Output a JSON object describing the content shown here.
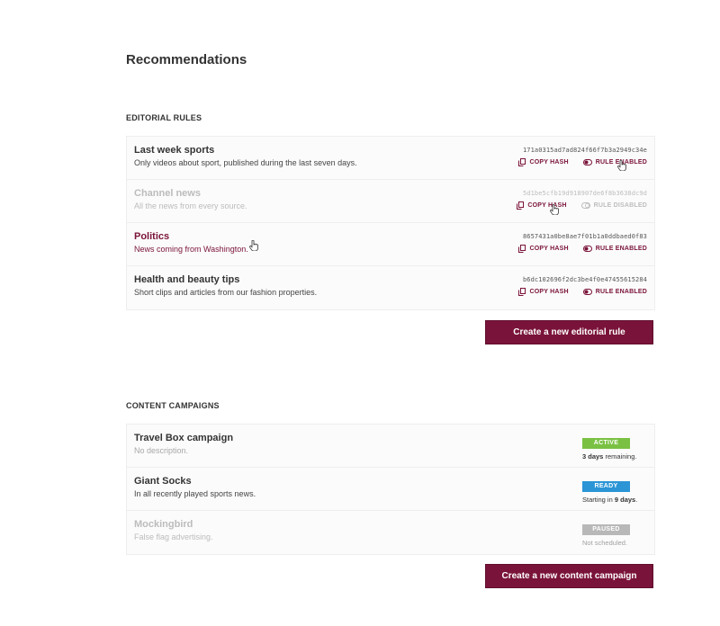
{
  "page": {
    "title": "Recommendations"
  },
  "editorial": {
    "section_label": "EDITORIAL RULES",
    "copy_label": "COPY HASH",
    "rules": [
      {
        "title": "Last week sports",
        "description": "Only videos about sport, published during the last seven days.",
        "hash": "171a0315ad7ad824f66f7b3a2949c34e",
        "rule_label": "RULE ENABLED"
      },
      {
        "title": "Channel news",
        "description": "All the news from every source.",
        "hash": "5d1be5cfb19d918907de6f8b3638dc9d",
        "rule_label": "RULE DISABLED"
      },
      {
        "title": "Politics",
        "description": "News coming from Washington.",
        "hash": "8657431a0be8ae7f01b1a0ddbaed0f83",
        "rule_label": "RULE ENABLED"
      },
      {
        "title": "Health and beauty tips",
        "description": "Short clips and articles from our fashion properties.",
        "hash": "b6dc102696f2dc3be4f0e47455615284",
        "rule_label": "RULE ENABLED"
      }
    ],
    "create_button": "Create a new editorial rule"
  },
  "campaigns": {
    "section_label": "CONTENT CAMPAIGNS",
    "items": [
      {
        "title": "Travel Box campaign",
        "description": "No description.",
        "status": "ACTIVE",
        "status_color": "#7ac143",
        "status_strong": "3 days",
        "status_rest": " remaining."
      },
      {
        "title": "Giant Socks",
        "description": "In all recently played sports news.",
        "status": "READY",
        "status_color": "#2b95d6",
        "status_pre": "Starting in ",
        "status_strong": "9 days",
        "status_rest": "."
      },
      {
        "title": "Mockingbird",
        "description": "False flag advertising.",
        "status": "PAUSED",
        "status_color": "#b8b8b8",
        "status_rest": "Not scheduled."
      }
    ],
    "create_button": "Create a new content campaign"
  },
  "colors": {
    "brand": "#7a1339",
    "active": "#7ac143",
    "ready": "#2b95d6",
    "paused": "#b8b8b8"
  },
  "icons": {
    "copy": "copy-icon",
    "toggle": "toggle-icon",
    "cursor": "hand-pointer-icon"
  }
}
